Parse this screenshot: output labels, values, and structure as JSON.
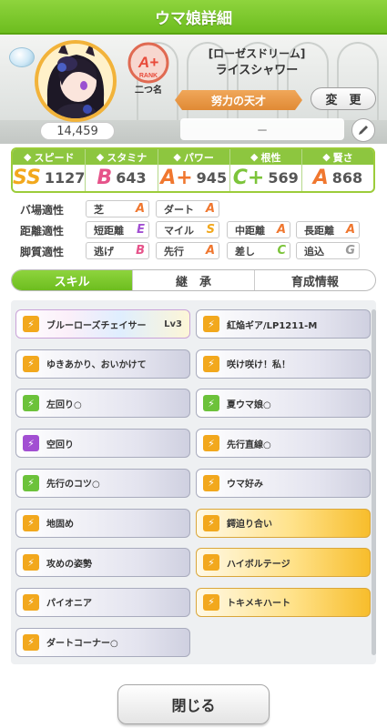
{
  "header": {
    "title": "ウマ娘詳細"
  },
  "profile": {
    "fan_count": "14,459",
    "rank": "A+",
    "rank_caption": "RANK",
    "rank_sub": "二つ名",
    "epithet": "[ローゼスドリーム]",
    "name": "ライスシャワー",
    "title_ribbon": "努力の天才",
    "change_label": "変　更",
    "nickname_field": "－"
  },
  "stats": [
    {
      "label": "スピード",
      "icon": "shoe-icon",
      "grade": "SS",
      "value": "1127",
      "color": "#f2a81d"
    },
    {
      "label": "スタミナ",
      "icon": "heart-icon",
      "grade": "B",
      "value": "643",
      "color": "#e6538a"
    },
    {
      "label": "パワー",
      "icon": "muscle-icon",
      "grade": "A+",
      "value": "945",
      "color": "#f0772f"
    },
    {
      "label": "根性",
      "icon": "flame-icon",
      "grade": "C+",
      "value": "569",
      "color": "#7cc43a"
    },
    {
      "label": "賢さ",
      "icon": "mortarboard-icon",
      "grade": "A",
      "value": "868",
      "color": "#f0772f"
    }
  ],
  "aptitude": {
    "track": {
      "label": "バ場適性",
      "items": [
        {
          "name": "芝",
          "grade": "A"
        },
        {
          "name": "ダート",
          "grade": "A"
        }
      ]
    },
    "distance": {
      "label": "距離適性",
      "items": [
        {
          "name": "短距離",
          "grade": "E"
        },
        {
          "name": "マイル",
          "grade": "S"
        },
        {
          "name": "中距離",
          "grade": "A"
        },
        {
          "name": "長距離",
          "grade": "A"
        }
      ]
    },
    "style": {
      "label": "脚質適性",
      "items": [
        {
          "name": "逃げ",
          "grade": "B"
        },
        {
          "name": "先行",
          "grade": "A"
        },
        {
          "name": "差し",
          "grade": "C"
        },
        {
          "name": "追込",
          "grade": "G"
        }
      ]
    }
  },
  "tabs": [
    "スキル",
    "継　承",
    "育成情報"
  ],
  "skills": [
    {
      "name": "ブルーローズチェイサー",
      "lv": "Lv3",
      "kind": "rainbow",
      "icon_color": "#f2a81d"
    },
    {
      "name": "紅焔ギア/LP1211-M",
      "lv": "",
      "kind": "normal",
      "icon_color": "#f2a81d"
    },
    {
      "name": "ゆきあかり、おいかけて",
      "lv": "",
      "kind": "normal",
      "icon_color": "#f2a81d"
    },
    {
      "name": "咲け咲け！私！",
      "lv": "",
      "kind": "normal",
      "icon_color": "#f2a81d"
    },
    {
      "name": "左回り○",
      "lv": "",
      "kind": "normal",
      "icon_color": "#6cc23a"
    },
    {
      "name": "夏ウマ娘○",
      "lv": "",
      "kind": "normal",
      "icon_color": "#6cc23a"
    },
    {
      "name": "空回り",
      "lv": "",
      "kind": "normal",
      "icon_color": "#a24fd2"
    },
    {
      "name": "先行直線○",
      "lv": "",
      "kind": "normal",
      "icon_color": "#f2a81d"
    },
    {
      "name": "先行のコツ○",
      "lv": "",
      "kind": "normal",
      "icon_color": "#6cc23a"
    },
    {
      "name": "ウマ好み",
      "lv": "",
      "kind": "normal",
      "icon_color": "#f2a81d"
    },
    {
      "name": "地固め",
      "lv": "",
      "kind": "normal",
      "icon_color": "#f2a81d"
    },
    {
      "name": "鍔迫り合い",
      "lv": "",
      "kind": "gold",
      "icon_color": "#f2a81d"
    },
    {
      "name": "攻めの姿勢",
      "lv": "",
      "kind": "normal",
      "icon_color": "#f2a81d"
    },
    {
      "name": "ハイボルテージ",
      "lv": "",
      "kind": "gold",
      "icon_color": "#f2a81d"
    },
    {
      "name": "パイオニア",
      "lv": "",
      "kind": "normal",
      "icon_color": "#f2a81d"
    },
    {
      "name": "トキメキハート",
      "lv": "",
      "kind": "gold",
      "icon_color": "#f2a81d"
    },
    {
      "name": "ダートコーナー○",
      "lv": "",
      "kind": "normal",
      "icon_color": "#f2a81d"
    }
  ],
  "footer": {
    "close_label": "閉じる"
  }
}
